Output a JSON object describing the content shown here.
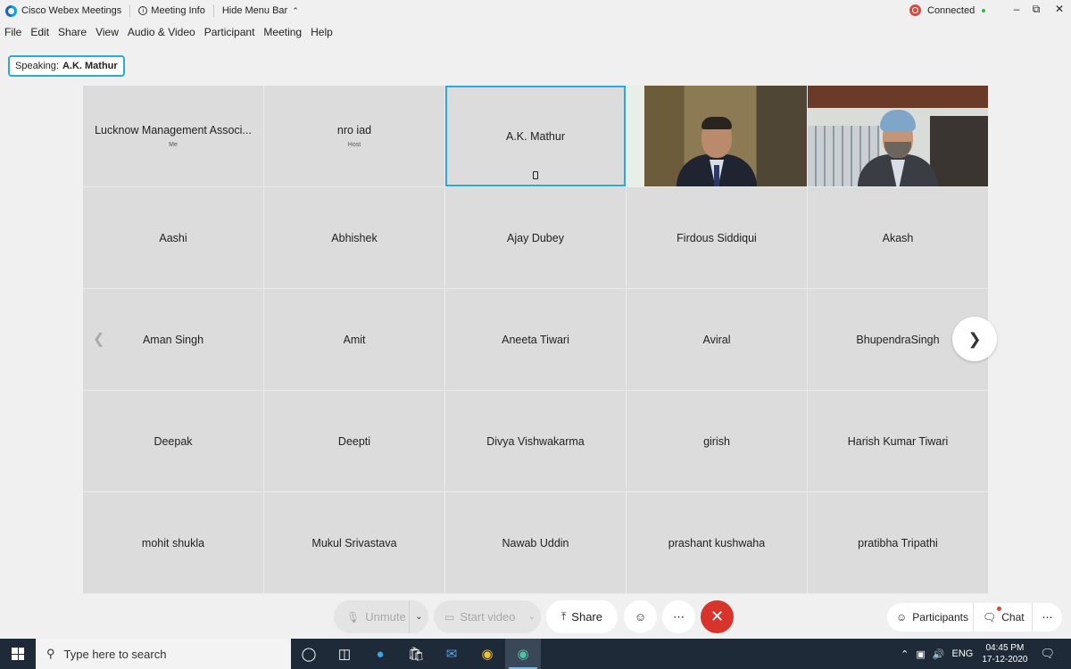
{
  "titlebar": {
    "app_name": "Cisco Webex Meetings",
    "meeting_info": "Meeting Info",
    "hide_menu_bar": "Hide Menu Bar",
    "status": "Connected",
    "status_color": "#2fb84a"
  },
  "menu": [
    "File",
    "Edit",
    "Share",
    "View",
    "Audio & Video",
    "Participant",
    "Meeting",
    "Help"
  ],
  "speaking": {
    "label": "Speaking:",
    "name": "A.K. Mathur"
  },
  "participants": [
    {
      "name": "Lucknow Management Associ...",
      "sub": "Me"
    },
    {
      "name": "nro iad",
      "sub": "Host"
    },
    {
      "name": "A.K. Mathur",
      "active": true
    },
    {
      "video": true
    },
    {
      "video": true
    },
    {
      "name": "Aashi"
    },
    {
      "name": "Abhishek"
    },
    {
      "name": "Ajay Dubey"
    },
    {
      "name": "Firdous Siddiqui"
    },
    {
      "name": "Akash"
    },
    {
      "name": "Aman Singh"
    },
    {
      "name": "Amit"
    },
    {
      "name": "Aneeta Tiwari"
    },
    {
      "name": "Aviral"
    },
    {
      "name": "BhupendraSingh"
    },
    {
      "name": "Deepak"
    },
    {
      "name": "Deepti"
    },
    {
      "name": "Divya Vishwakarma"
    },
    {
      "name": "girish"
    },
    {
      "name": "Harish Kumar Tiwari"
    },
    {
      "name": "mohit shukla"
    },
    {
      "name": "Mukul Srivastava"
    },
    {
      "name": "Nawab Uddin"
    },
    {
      "name": "prashant kushwaha"
    },
    {
      "name": "pratibha Tripathi"
    }
  ],
  "controls": {
    "unmute": "Unmute",
    "start_video": "Start video",
    "share": "Share",
    "participants": "Participants",
    "chat": "Chat",
    "end_color": "#d9342b"
  },
  "taskbar": {
    "search_placeholder": "Type here to search",
    "lang": "ENG",
    "time": "04:45 PM",
    "date": "17-12-2020"
  }
}
